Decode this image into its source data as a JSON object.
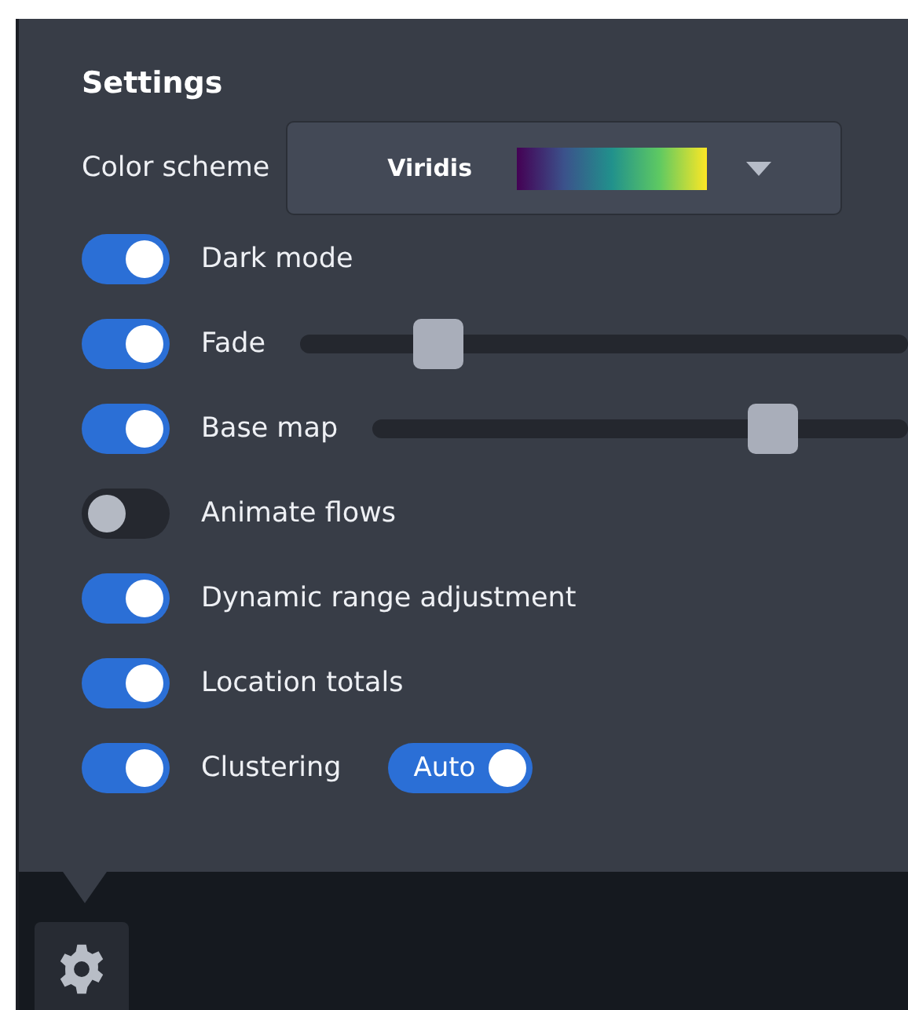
{
  "panel": {
    "title": "Settings"
  },
  "color_scheme": {
    "label": "Color scheme",
    "value": "Viridis"
  },
  "settings": [
    {
      "kind": "toggle",
      "label": "Dark mode",
      "on": true
    },
    {
      "kind": "slider",
      "label": "Fade",
      "on": true,
      "level": 0.23
    },
    {
      "kind": "slider",
      "label": "Base map",
      "on": true,
      "level": 0.75
    },
    {
      "kind": "toggle",
      "label": "Animate flows",
      "on": false
    },
    {
      "kind": "toggle",
      "label": "Dynamic range adjustment",
      "on": true
    },
    {
      "kind": "toggle",
      "label": "Location totals",
      "on": true
    },
    {
      "kind": "auto",
      "label": "Clustering",
      "on": true,
      "auto": {
        "label": "Auto",
        "on": true
      }
    }
  ]
}
